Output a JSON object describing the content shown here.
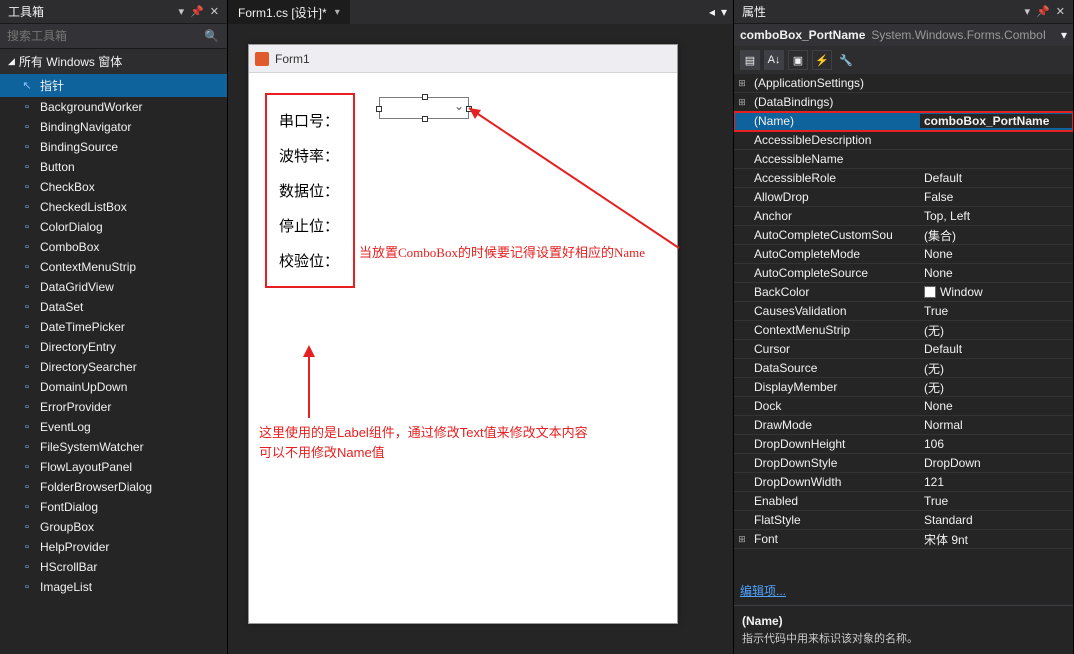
{
  "toolbox": {
    "title": "工具箱",
    "search_placeholder": "搜索工具箱",
    "category": "所有 Windows 窗体",
    "items": [
      "指针",
      "BackgroundWorker",
      "BindingNavigator",
      "BindingSource",
      "Button",
      "CheckBox",
      "CheckedListBox",
      "ColorDialog",
      "ComboBox",
      "ContextMenuStrip",
      "DataGridView",
      "DataSet",
      "DateTimePicker",
      "DirectoryEntry",
      "DirectorySearcher",
      "DomainUpDown",
      "ErrorProvider",
      "EventLog",
      "FileSystemWatcher",
      "FlowLayoutPanel",
      "FolderBrowserDialog",
      "FontDialog",
      "GroupBox",
      "HelpProvider",
      "HScrollBar",
      "ImageList"
    ],
    "selected_index": 0
  },
  "designer": {
    "tab_title": "Form1.cs [设计]*",
    "form_title": "Form1",
    "labels": [
      "串口号：",
      "波特率：",
      "数据位：",
      "停止位：",
      "校验位："
    ],
    "annotation1": "当放置ComboBox的时候要记得设置好相应的Name",
    "annotation2a": "这里使用的是Label组件，通过修改Text值来修改文本内容",
    "annotation2b": "可以不用修改Name值"
  },
  "properties": {
    "title": "属性",
    "object_name": "comboBox_PortName",
    "object_type": "System.Windows.Forms.ComboI",
    "rows": [
      {
        "exp": "⊞",
        "key": "(ApplicationSettings)",
        "val": ""
      },
      {
        "exp": "⊞",
        "key": "(DataBindings)",
        "val": ""
      },
      {
        "exp": "",
        "key": "(Name)",
        "val": "comboBox_PortName",
        "sel": true,
        "hl": true
      },
      {
        "exp": "",
        "key": "AccessibleDescription",
        "val": ""
      },
      {
        "exp": "",
        "key": "AccessibleName",
        "val": ""
      },
      {
        "exp": "",
        "key": "AccessibleRole",
        "val": "Default"
      },
      {
        "exp": "",
        "key": "AllowDrop",
        "val": "False"
      },
      {
        "exp": "",
        "key": "Anchor",
        "val": "Top, Left"
      },
      {
        "exp": "",
        "key": "AutoCompleteCustomSou",
        "val": "(集合)"
      },
      {
        "exp": "",
        "key": "AutoCompleteMode",
        "val": "None"
      },
      {
        "exp": "",
        "key": "AutoCompleteSource",
        "val": "None"
      },
      {
        "exp": "",
        "key": "BackColor",
        "val": "Window",
        "swatch": true
      },
      {
        "exp": "",
        "key": "CausesValidation",
        "val": "True"
      },
      {
        "exp": "",
        "key": "ContextMenuStrip",
        "val": "(无)"
      },
      {
        "exp": "",
        "key": "Cursor",
        "val": "Default"
      },
      {
        "exp": "",
        "key": "DataSource",
        "val": "(无)"
      },
      {
        "exp": "",
        "key": "DisplayMember",
        "val": "(无)"
      },
      {
        "exp": "",
        "key": "Dock",
        "val": "None"
      },
      {
        "exp": "",
        "key": "DrawMode",
        "val": "Normal"
      },
      {
        "exp": "",
        "key": "DropDownHeight",
        "val": "106"
      },
      {
        "exp": "",
        "key": "DropDownStyle",
        "val": "DropDown"
      },
      {
        "exp": "",
        "key": "DropDownWidth",
        "val": "121"
      },
      {
        "exp": "",
        "key": "Enabled",
        "val": "True"
      },
      {
        "exp": "",
        "key": "FlatStyle",
        "val": "Standard"
      },
      {
        "exp": "⊞",
        "key": "Font",
        "val": "宋体 9nt"
      }
    ],
    "link": "编辑项...",
    "desc_name": "(Name)",
    "desc_text": "指示代码中用来标识该对象的名称。"
  }
}
